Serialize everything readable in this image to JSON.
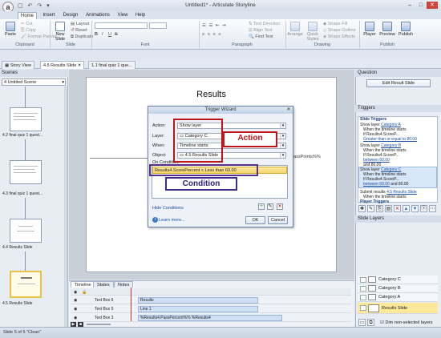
{
  "app": {
    "window_title": "Untitled1* - Articulate Storyline",
    "logo_letter": "a",
    "quick_access": "▢ ↶ ↷ ▾",
    "controls": {
      "minimize": "–",
      "restore": "□",
      "close": "✕"
    }
  },
  "ribbon": {
    "tabs": [
      "Home",
      "Insert",
      "Design",
      "Animations",
      "View",
      "Help"
    ],
    "clipboard": {
      "paste": "Paste",
      "cut": "Cut",
      "copy": "Copy",
      "format_painter": "Format Painter",
      "group": "Clipboard"
    },
    "slide": {
      "new_slide": "New Slide",
      "layout": "Layout",
      "reset": "Reset",
      "duplicate": "Duplicate",
      "group": "Slide"
    },
    "font": {
      "group": "Font",
      "bold": "B",
      "italic": "I",
      "underline": "U",
      "strike": "S"
    },
    "paragraph": {
      "group": "Paragraph",
      "text_direction": "Text Direction",
      "align_text": "Align Text",
      "find_text": "Find Text"
    },
    "drawing": {
      "group": "Drawing",
      "arrange": "Arrange",
      "quick_styles": "Quick Styles",
      "shape_fill": "Shape Fill",
      "shape_outline": "Shape Outline",
      "shape_effects": "Shape Effects"
    },
    "publish": {
      "group": "Publish",
      "player": "Player",
      "preview": "Preview",
      "publish": "Publish"
    }
  },
  "doc_tabs": [
    "Story View",
    "4.5 Results Slide",
    "1.1 final quiz 1 que..."
  ],
  "scenes": {
    "header": "Scenes",
    "selected": "4 Untitled Scene",
    "thumbs": [
      {
        "label": "4.2 final quiz 1 quest..."
      },
      {
        "label": "4.3 final quiz 1 quest..."
      },
      {
        "label": "4.4 Results Slide"
      },
      {
        "label": "4.5 Results Slide"
      }
    ]
  },
  "slide": {
    "title": "Results",
    "passpoints": "%.PassPoints%%"
  },
  "dialog": {
    "title": "Trigger Wizard",
    "close": "✕",
    "fields": [
      {
        "label": "Action:",
        "value": "Show layer"
      },
      {
        "label": "Layer:",
        "value": "Category C"
      },
      {
        "label": "When:",
        "value": "Timeline starts"
      },
      {
        "label": "Object:",
        "value": "4.5 Results Slide"
      }
    ],
    "on_condition": "On Condition:",
    "condition_text": "Results4.ScorePercent  < Less than 60.00",
    "hide_conditions": "Hide Conditions",
    "learn_more": "Learn more...",
    "ok": "OK",
    "cancel": "Cancel"
  },
  "annotations": {
    "action": "Action",
    "condition": "Condition",
    "action_color": "#c0141b",
    "condition_color": "#2a1f7a"
  },
  "right_panel": {
    "question_header": "Question",
    "edit_result_slide": "Edit Result Slide",
    "triggers_header": "Triggers",
    "slide_triggers": "Slide Triggers",
    "triggers": [
      {
        "action": "Show layer",
        "target": "Category A",
        "when": "When the timeline starts",
        "cond_pre": "If Results4.ScoreP...",
        "cond_link": "Greater than or equal to 80.00"
      },
      {
        "action": "Show layer",
        "target": "Category B",
        "when": "When the timeline starts",
        "cond_pre": "If Results4.ScoreP...",
        "cond_link": "between 60.00",
        "cond_and": "and 80.00"
      },
      {
        "action": "Show layer",
        "target": "Category C",
        "when": "When the timeline starts",
        "cond_pre": "If Results4.ScoreP...",
        "cond_link": "between 60.00",
        "cond_and": "and 80.00"
      },
      {
        "action": "Submit results",
        "target": "4.5 Results Slide",
        "when": "When the timeline starts"
      }
    ],
    "player_triggers": "Player Triggers",
    "layers_header": "Slide Layers",
    "layers": [
      "Category C",
      "Category B",
      "Category A",
      "Results Slide"
    ],
    "dim_label": "Dim non-selected layers"
  },
  "timeline": {
    "tabs": [
      "Timeline",
      "States",
      "Notes"
    ],
    "rows": [
      {
        "label": "Text Box 6",
        "bar": "Results"
      },
      {
        "label": "Text Box 5",
        "bar": "Line 1"
      },
      {
        "label": "Text Box 3",
        "bar": "%Results4.PassPercent%% %Results4"
      }
    ]
  },
  "status": {
    "text": "Slide 5 of 5     \"Clean\""
  }
}
